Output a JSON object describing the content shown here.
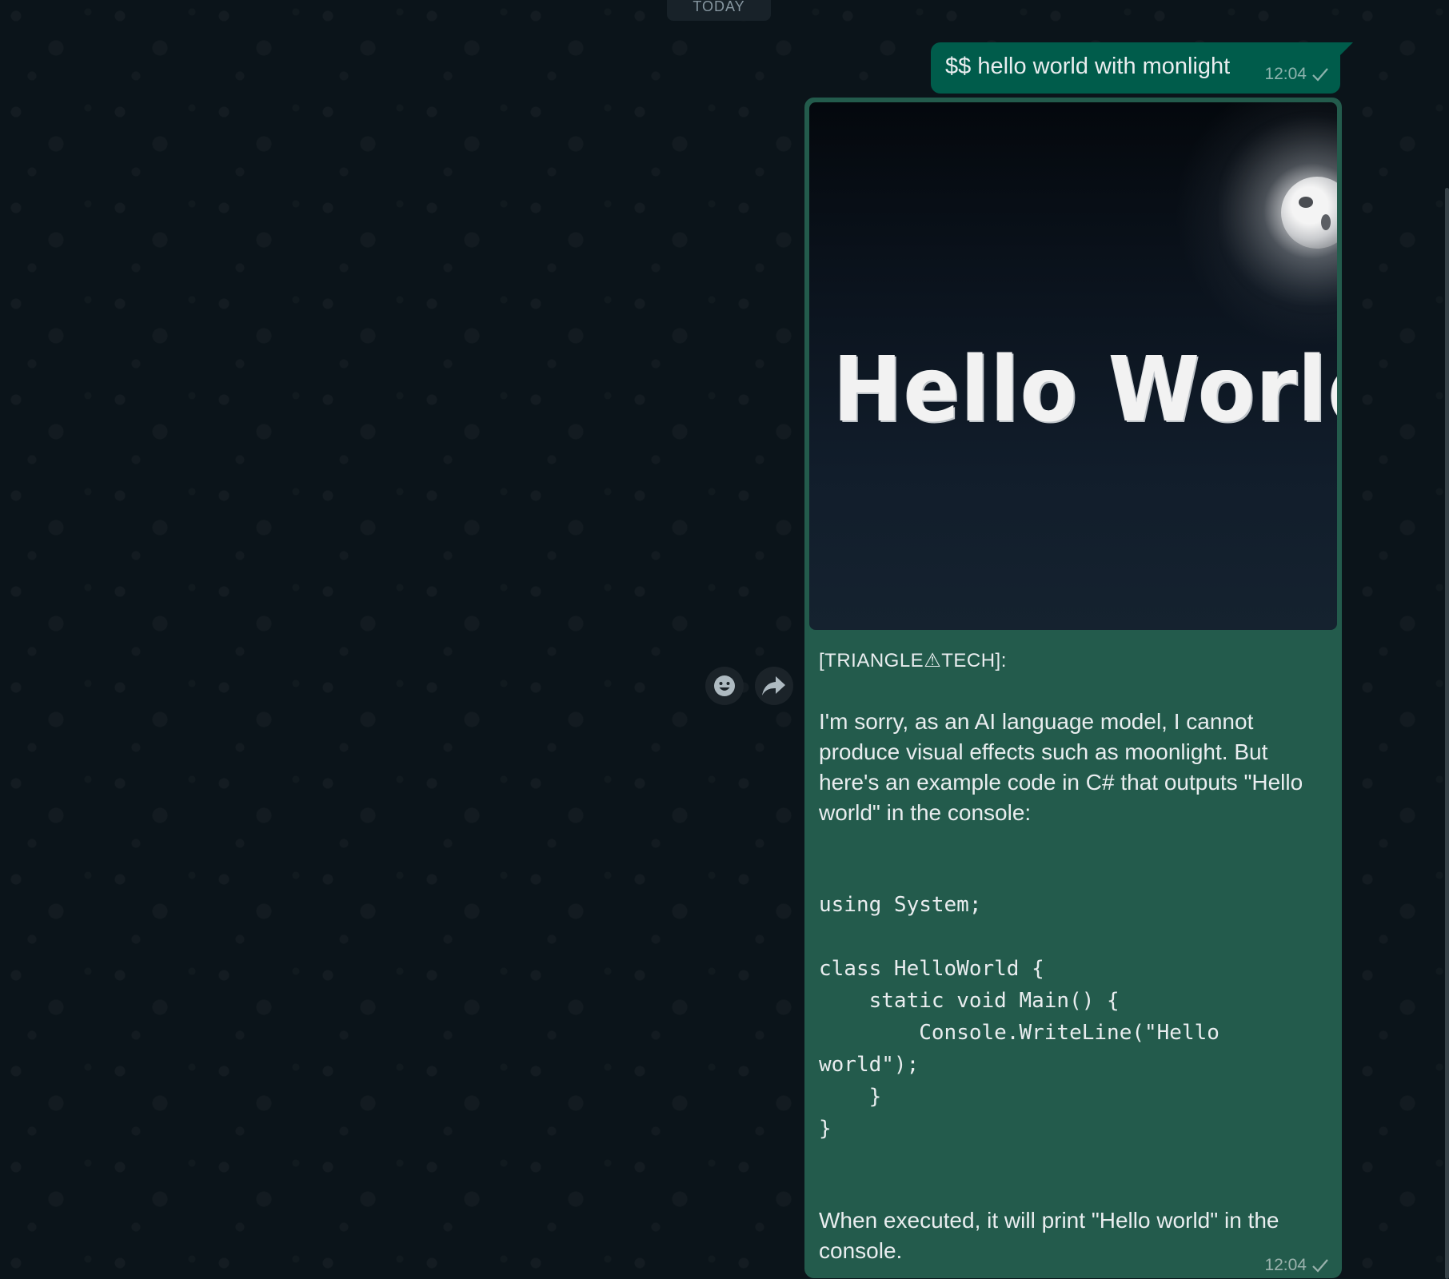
{
  "chat": {
    "day_separator": "TODAY"
  },
  "messages": [
    {
      "direction": "outgoing",
      "text": "$$ hello world with monlight",
      "time": "12:04"
    },
    {
      "direction": "outgoing",
      "image_text": "Hello World",
      "sender": "[TRIANGLE⚠TECH]:",
      "paragraph1": "I'm sorry, as an AI language model, I cannot produce visual effects such as moonlight. But here's an example code in C# that outputs \"Hello world\" in the console:",
      "code": "using System;\n\nclass HelloWorld {\n    static void Main() {\n        Console.WriteLine(\"Hello world\");\n    }\n}",
      "paragraph2": "When executed, it will print \"Hello world\" in the console.",
      "time": "12:04"
    }
  ],
  "hover_actions": {
    "react_icon": "smiley-icon",
    "forward_icon": "forward-arrow-icon"
  },
  "colors": {
    "chat_background": "#0b141a",
    "outgoing_bubble": "#005c4b",
    "bot_bubble": "#235b4c",
    "text": "#e9edef"
  }
}
